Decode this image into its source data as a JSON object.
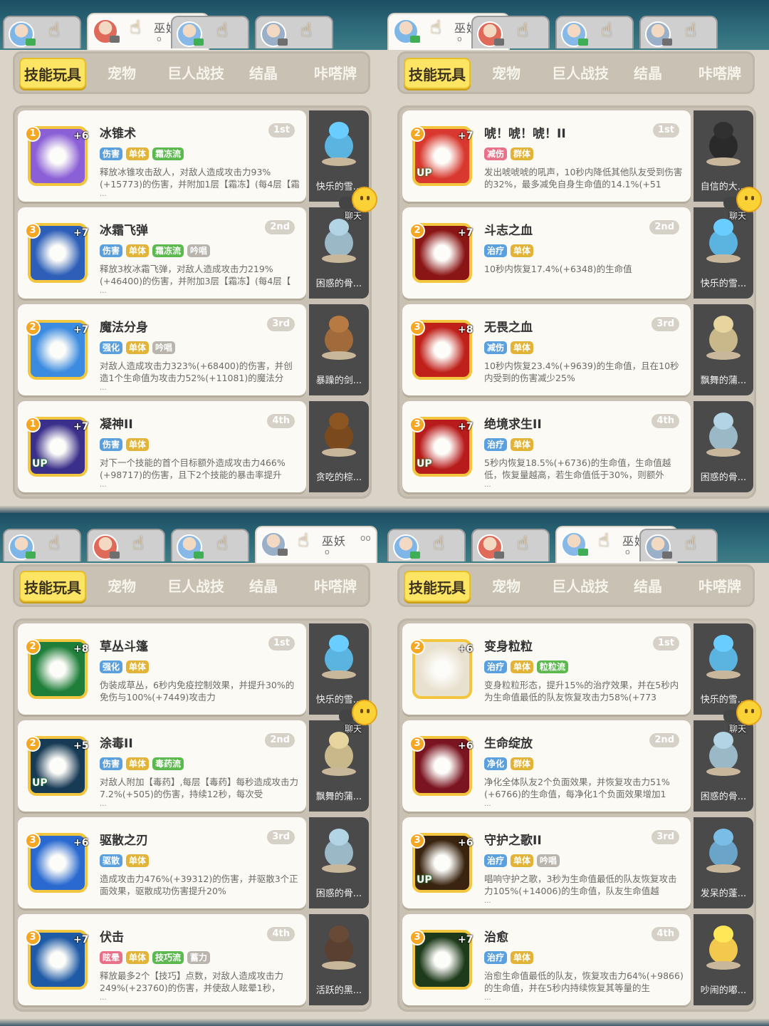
{
  "tabs": [
    "技能玩具",
    "宠物",
    "巨人战技",
    "结晶",
    "咔嗒牌"
  ],
  "chat_label": "聊天",
  "active_char_name": "巫妖",
  "active_char_dots": "oo",
  "active_char_sub": "o",
  "panels": [
    {
      "active_tab_index": 0,
      "skills": [
        {
          "title": "冰锥术",
          "rank": "1st",
          "level": "1",
          "plus": "+6",
          "up": "",
          "tags": [
            [
              "伤害",
              "blue"
            ],
            [
              "单体",
              "yellow"
            ],
            [
              "霜冻流",
              "green"
            ]
          ],
          "desc": "释放冰锥攻击敌人，对敌人造成攻击力93%(+15773)的伤害，并附加1层【霜冻】(每4层【霜",
          "ell": "...",
          "pet": "快乐的雪..."
        },
        {
          "title": "冰霜飞弹",
          "rank": "2nd",
          "level": "3",
          "plus": "+7",
          "up": "",
          "tags": [
            [
              "伤害",
              "blue"
            ],
            [
              "单体",
              "yellow"
            ],
            [
              "霜冻流",
              "green"
            ],
            [
              "吟唱",
              "gray"
            ]
          ],
          "desc": "释放3枚冰霜飞弹，对敌人造成攻击力219%(+46400)的伤害，并附加3层【霜冻】(每4层【",
          "ell": "...",
          "pet": "困惑的骨..."
        },
        {
          "title": "魔法分身",
          "rank": "3rd",
          "level": "2",
          "plus": "+7",
          "up": "",
          "tags": [
            [
              "强化",
              "blue"
            ],
            [
              "单体",
              "yellow"
            ],
            [
              "吟唱",
              "gray"
            ]
          ],
          "desc": "对敌人造成攻击力323%(+68400)的伤害，并创造1个生命值为攻击力52%(+11081)的魔法分",
          "ell": "...",
          "pet": "暴躁的剑..."
        },
        {
          "title": "凝神II",
          "rank": "4th",
          "level": "1",
          "plus": "+7",
          "up": "UP",
          "tags": [
            [
              "伤害",
              "blue"
            ],
            [
              "单体",
              "yellow"
            ]
          ],
          "desc": "对下一个技能的首个目标额外造成攻击力466%(+98717)的伤害，且下2个技能的暴击率提升",
          "ell": "...",
          "pet": "贪吃的棕..."
        }
      ]
    },
    {
      "active_tab_index": 0,
      "skills": [
        {
          "title": "唬！唬！唬！II",
          "rank": "1st",
          "level": "2",
          "plus": "+7",
          "up": "UP",
          "tags": [
            [
              "减伤",
              "pink"
            ],
            [
              "群体",
              "yellow"
            ]
          ],
          "desc": "发出唬唬唬的吼声，10秒内降低其他队友受到伤害的32%，最多减免自身生命值的14.1%(+51",
          "ell": "",
          "pet": "自信的大..."
        },
        {
          "title": "斗志之血",
          "rank": "2nd",
          "level": "2",
          "plus": "+7",
          "up": "",
          "tags": [
            [
              "治疗",
              "blue"
            ],
            [
              "单体",
              "yellow"
            ]
          ],
          "desc": "10秒内恢复17.4%(+6348)的生命值",
          "ell": "",
          "pet": "快乐的雪..."
        },
        {
          "title": "无畏之血",
          "rank": "3rd",
          "level": "3",
          "plus": "+8",
          "up": "",
          "tags": [
            [
              "减伤",
              "blue"
            ],
            [
              "单体",
              "yellow"
            ]
          ],
          "desc": "10秒内恢复23.4%(+9639)的生命值，且在10秒内受到的伤害减少25%",
          "ell": "",
          "pet": "飘舞的蒲..."
        },
        {
          "title": "绝境求生II",
          "rank": "4th",
          "level": "3",
          "plus": "+7",
          "up": "UP",
          "tags": [
            [
              "治疗",
              "blue"
            ],
            [
              "单体",
              "yellow"
            ]
          ],
          "desc": "5秒内恢复18.5%(+6736)的生命值，生命值越低，恢复量越高，若生命值低于30%，则额外",
          "ell": "...",
          "pet": "困惑的骨..."
        }
      ]
    },
    {
      "active_tab_index": 0,
      "skills": [
        {
          "title": "草丛斗篷",
          "rank": "1st",
          "level": "2",
          "plus": "+8",
          "up": "",
          "tags": [
            [
              "强化",
              "blue"
            ],
            [
              "单体",
              "yellow"
            ]
          ],
          "desc": "伪装成草丛，6秒内免疫控制效果，并提升30%的免伤与100%(+7449)攻击力",
          "ell": "",
          "pet": "快乐的雪..."
        },
        {
          "title": "涂毒II",
          "rank": "2nd",
          "level": "2",
          "plus": "+5",
          "up": "UP",
          "tags": [
            [
              "伤害",
              "blue"
            ],
            [
              "单体",
              "yellow"
            ],
            [
              "毒药流",
              "green"
            ]
          ],
          "desc": "对敌人附加【毒药】,每层【毒药】每秒造成攻击力7.2%(+505)的伤害，持续12秒，每次受",
          "ell": "...",
          "pet": "飘舞的蒲..."
        },
        {
          "title": "驱散之刃",
          "rank": "3rd",
          "level": "3",
          "plus": "+6",
          "up": "",
          "tags": [
            [
              "驱散",
              "blue"
            ],
            [
              "单体",
              "yellow"
            ]
          ],
          "desc": "造成攻击力476%(+39312)的伤害，并驱散3个正面效果，驱散成功伤害提升20%",
          "ell": "",
          "pet": "困惑的骨..."
        },
        {
          "title": "伏击",
          "rank": "4th",
          "level": "3",
          "plus": "+7",
          "up": "",
          "tags": [
            [
              "眩晕",
              "pink"
            ],
            [
              "单体",
              "yellow"
            ],
            [
              "技巧流",
              "green"
            ],
            [
              "蓄力",
              "gray"
            ]
          ],
          "desc": "释放最多2个【技巧】点数，对敌人造成攻击力249%(+23760)的伤害，并使敌人眩晕1秒，",
          "ell": "...",
          "pet": "活跃的黑..."
        }
      ]
    },
    {
      "active_tab_index": 0,
      "skills": [
        {
          "title": "变身粒粒",
          "rank": "1st",
          "level": "2",
          "plus": "+6",
          "up": "",
          "tags": [
            [
              "治疗",
              "blue"
            ],
            [
              "单体",
              "yellow"
            ],
            [
              "粒粒流",
              "green"
            ]
          ],
          "desc": "变身粒粒形态，提升15%的治疗效果，并在5秒内为生命值最低的队友恢复攻击力58%(+773",
          "ell": "",
          "pet": "快乐的雪..."
        },
        {
          "title": "生命绽放",
          "rank": "2nd",
          "level": "3",
          "plus": "+6",
          "up": "",
          "tags": [
            [
              "净化",
              "blue"
            ],
            [
              "群体",
              "yellow"
            ]
          ],
          "desc": "净化全体队友2个负面效果，并恢复攻击力51%(+6766)的生命值，每净化1个负面效果增加1",
          "ell": "...",
          "pet": "困惑的骨..."
        },
        {
          "title": "守护之歌II",
          "rank": "3rd",
          "level": "3",
          "plus": "+6",
          "up": "UP",
          "tags": [
            [
              "治疗",
              "blue"
            ],
            [
              "单体",
              "yellow"
            ],
            [
              "吟唱",
              "gray"
            ]
          ],
          "desc": "唱响守护之歌，3秒为生命值最低的队友恢复攻击力105%(+14006)的生命值，队友生命值越",
          "ell": "...",
          "pet": "发呆的蓬..."
        },
        {
          "title": "治愈",
          "rank": "4th",
          "level": "3",
          "plus": "+7",
          "up": "",
          "tags": [
            [
              "治疗",
              "blue"
            ],
            [
              "单体",
              "yellow"
            ]
          ],
          "desc": "治愈生命值最低的队友，恢复攻击力64%(+9866)的生命值，并在5秒内持续恢复其等量的生",
          "ell": "...",
          "pet": "吵闹的嘟..."
        }
      ]
    }
  ],
  "colors": {
    "icon_bgs": [
      "#8b5fd6",
      "#2d5fb8",
      "#3b8be0",
      "#3a2f8a",
      "#d8382e",
      "#8a1515",
      "#c0201a",
      "#b81b1b",
      "#1f7f3a",
      "#173a55",
      "#2a6ad0",
      "#1e5aa5",
      "#e9e1d0",
      "#7a1420",
      "#3a2410",
      "#1d3a1a"
    ],
    "pet_colors": [
      "#5bb3e0",
      "#9bb8c7",
      "#a06a3a",
      "#7a4a1e",
      "#2a2a2a",
      "#5bb3e0",
      "#c9b98a",
      "#9bb8c7",
      "#5bb3e0",
      "#c9b98a",
      "#9bb8c7",
      "#5a4030",
      "#5bb3e0",
      "#9bb8c7",
      "#6aa4c8",
      "#f2c94c"
    ]
  }
}
